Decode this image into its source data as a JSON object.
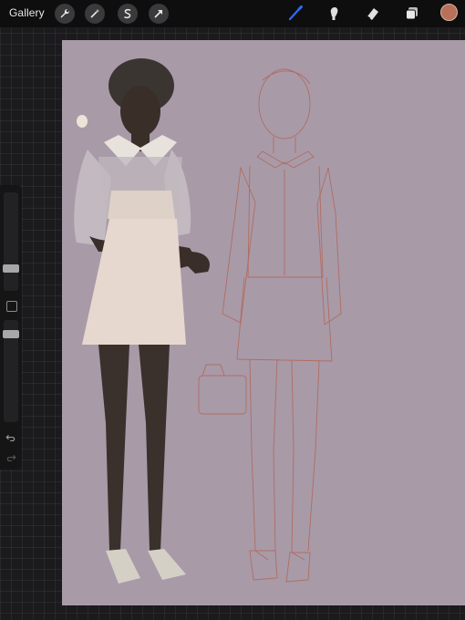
{
  "app": {
    "gallery_label": "Gallery"
  },
  "toolbar": {
    "left_tools": [
      "wrench-icon",
      "magic-wand-icon",
      "selection-s-icon",
      "transform-arrow-icon"
    ],
    "right_tools": [
      "brush-icon",
      "smudge-icon",
      "eraser-icon",
      "layers-icon"
    ],
    "active_tool": "brush-icon",
    "active_color": "#b87058",
    "accent_color": "#2f6df6"
  },
  "sidebar": {
    "brush_size_level": 0.7,
    "opacity_level": 0.65
  },
  "canvas": {
    "background_color": "#a99aa8",
    "sketch_color": "#b06655"
  }
}
